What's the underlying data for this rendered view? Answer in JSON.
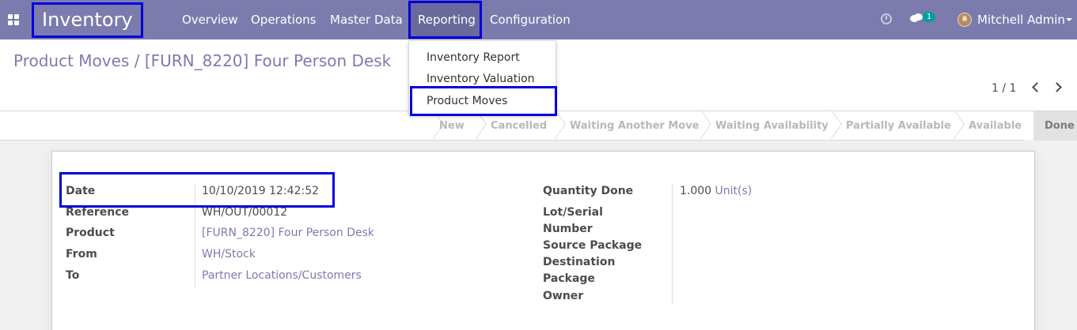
{
  "topbar": {
    "app_title": "Inventory",
    "menu": [
      "Overview",
      "Operations",
      "Master Data",
      "Reporting",
      "Configuration"
    ],
    "active_menu": "Reporting",
    "chat_count": "1",
    "user_name": "Mitchell Admin",
    "accent": "#7c7bad",
    "icons": [
      "apps-grid-icon",
      "clock-icon",
      "chat-icon",
      "avatar"
    ]
  },
  "dropdown": {
    "items": [
      "Inventory Report",
      "Inventory Valuation",
      "Product Moves"
    ],
    "highlighted": "Product Moves"
  },
  "breadcrumb": {
    "parent": "Product Moves",
    "separator": "/",
    "current": "[FURN_8220] Four Person Desk"
  },
  "pager": {
    "value": "1 / 1"
  },
  "statusbar": {
    "stages": [
      "New",
      "Cancelled",
      "Waiting Another Move",
      "Waiting Availability",
      "Partially Available",
      "Available",
      "Done"
    ],
    "current": "Done"
  },
  "form": {
    "left": [
      {
        "label": "Date",
        "value": "10/10/2019 12:42:52",
        "link": false
      },
      {
        "label": "Reference",
        "value": "WH/OUT/00012",
        "link": false
      },
      {
        "label": "Product",
        "value": "[FURN_8220] Four Person Desk",
        "link": true
      },
      {
        "label": "From",
        "value": "WH/Stock",
        "link": true
      },
      {
        "label": "To",
        "value": "Partner Locations/Customers",
        "link": true
      }
    ],
    "right": {
      "quantity_label": "Quantity Done",
      "quantity_value": "1.000",
      "quantity_unit": "Unit(s)",
      "lot_label": "Lot/Serial Number",
      "source_package_label": "Source Package",
      "destination_package_label": "Destination Package",
      "owner_label": "Owner"
    }
  }
}
